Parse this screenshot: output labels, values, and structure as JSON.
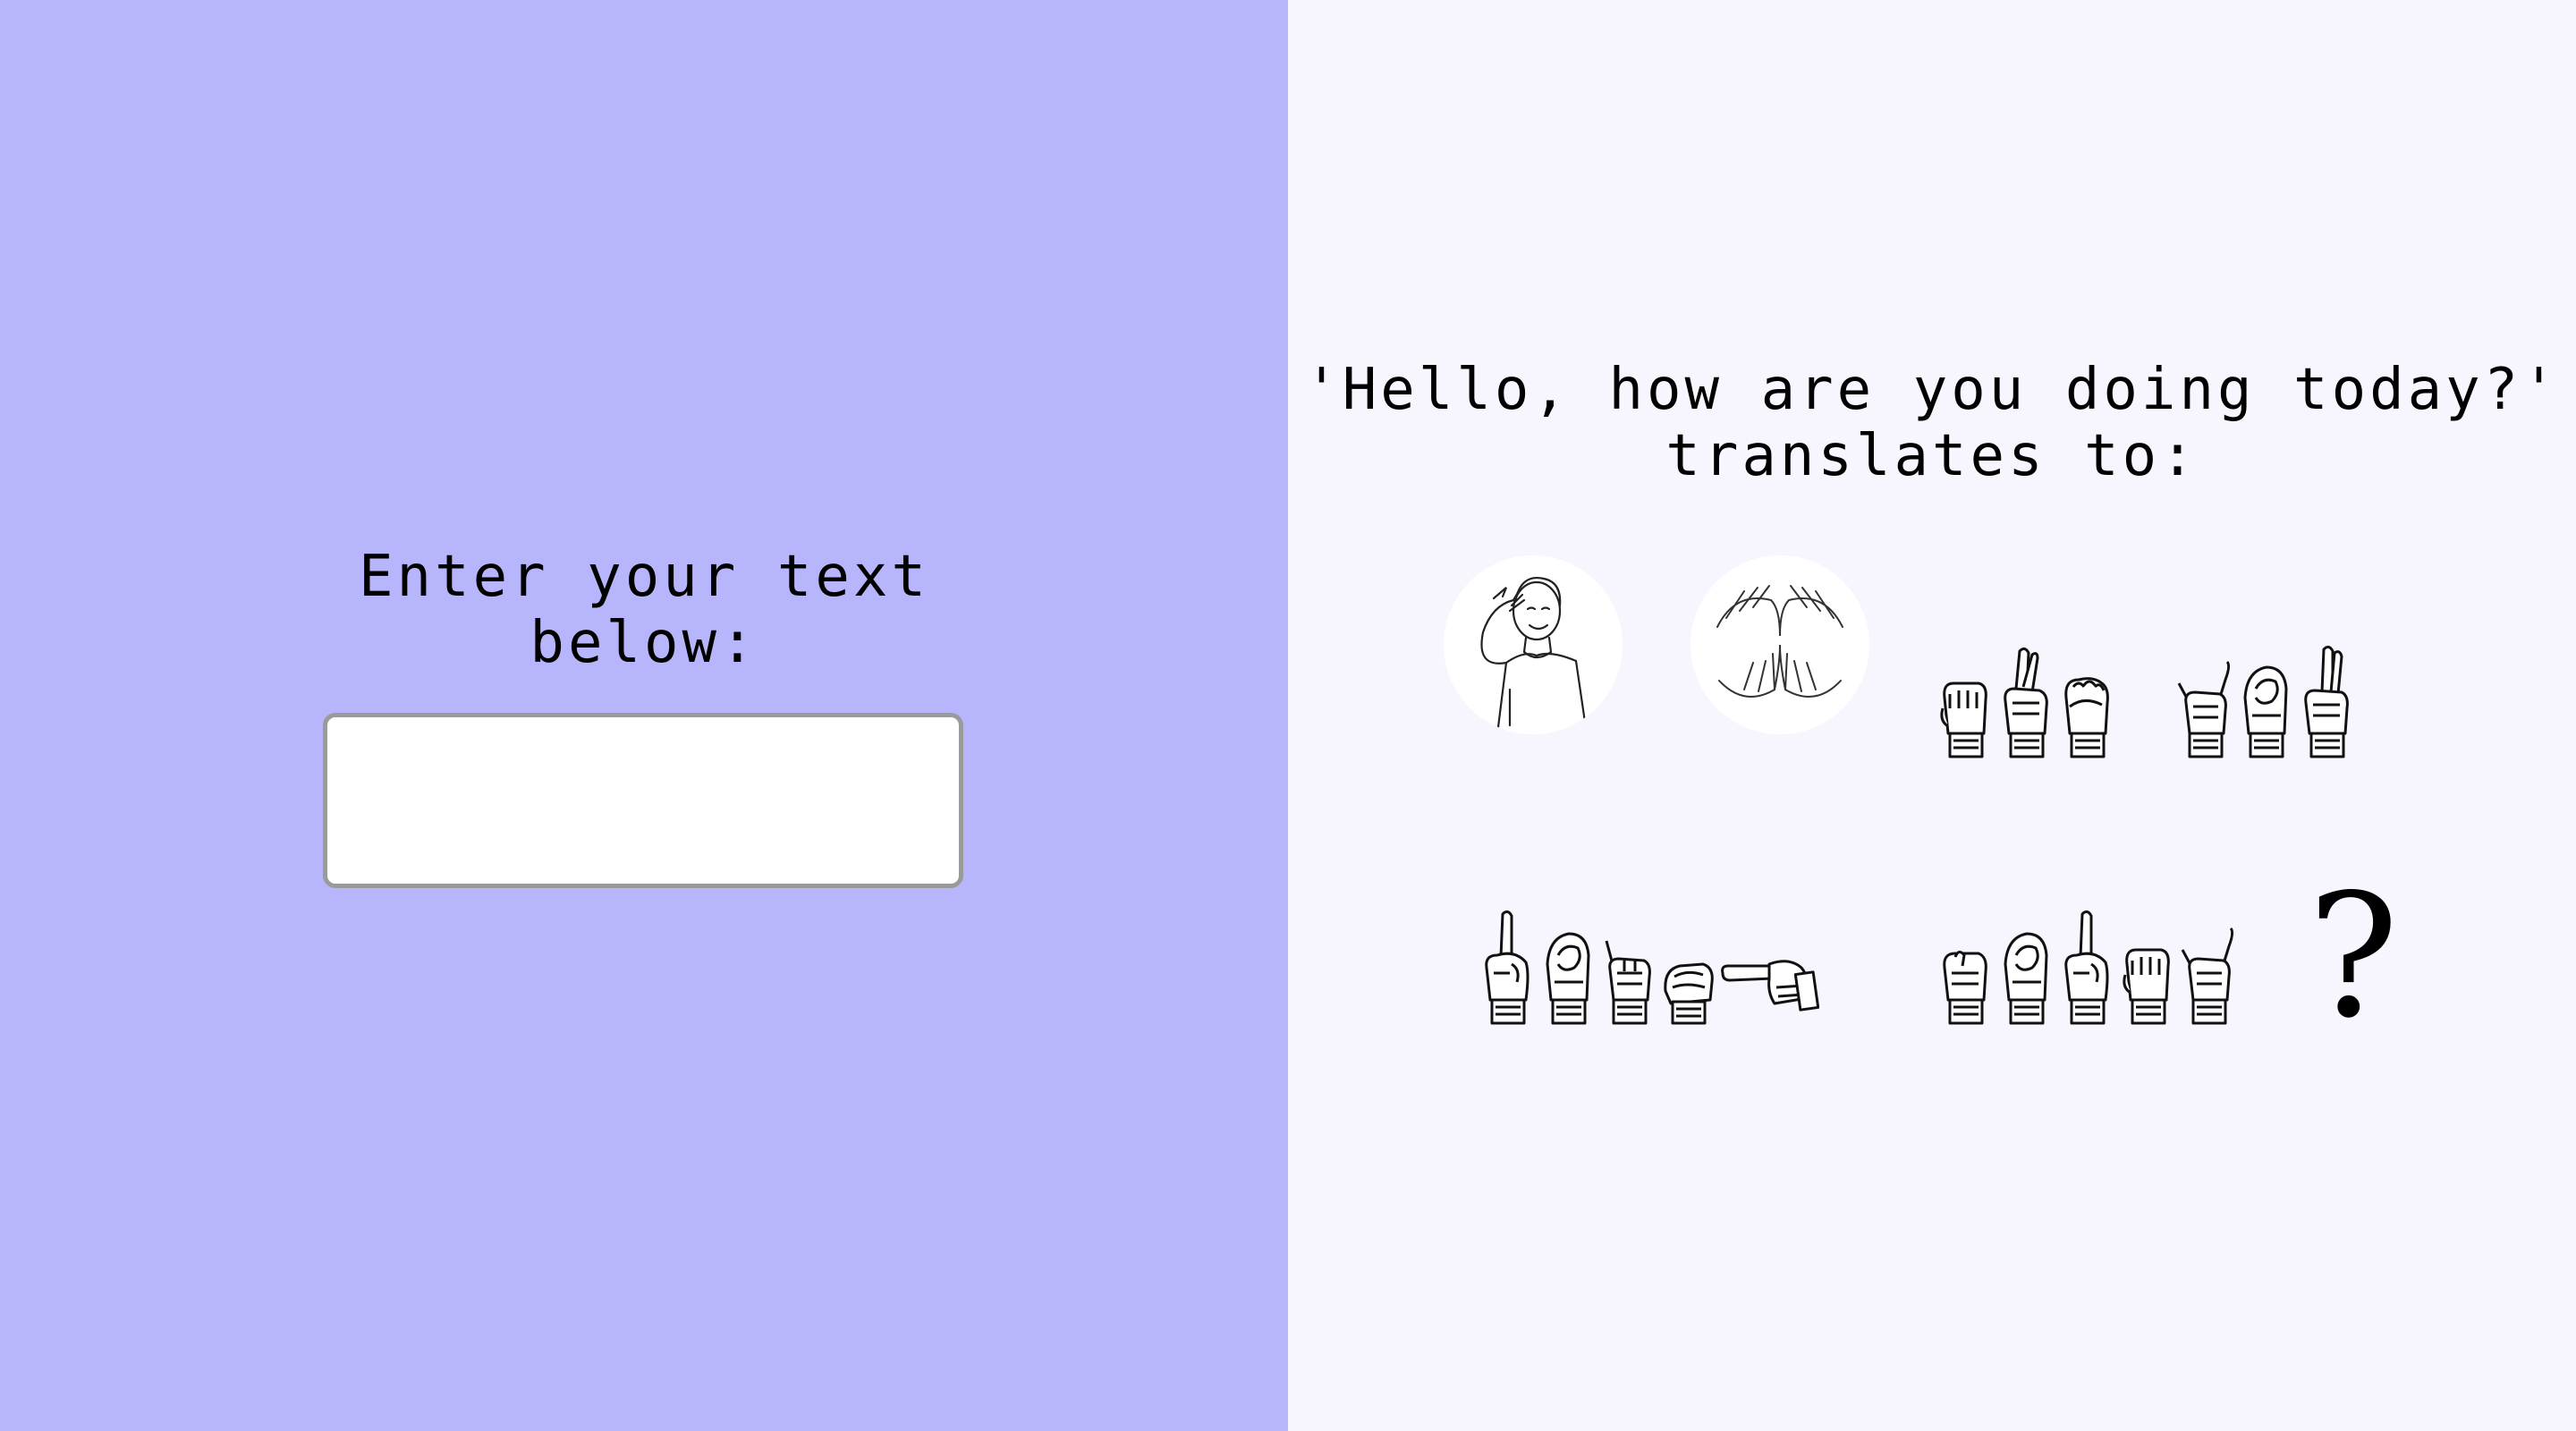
{
  "input_panel": {
    "prompt_line1": "Enter your text",
    "prompt_line2": "below:",
    "input_value": "",
    "input_placeholder": "",
    "background_color": "#b7b6fc"
  },
  "output_panel": {
    "title_line1": "'Hello, how are you doing today?'",
    "title_line2": "translates to:",
    "background_color": "#f7f6fe",
    "signs": [
      {
        "type": "image",
        "icon": "hello-sign-illustration"
      },
      {
        "type": "image",
        "icon": "how-sign-illustration"
      },
      {
        "type": "fingerspell",
        "word": "are"
      },
      {
        "type": "fingerspell",
        "word": "you"
      },
      {
        "type": "fingerspell",
        "word": "doing"
      },
      {
        "type": "fingerspell",
        "word": "today"
      },
      {
        "type": "text",
        "value": "?"
      }
    ]
  }
}
